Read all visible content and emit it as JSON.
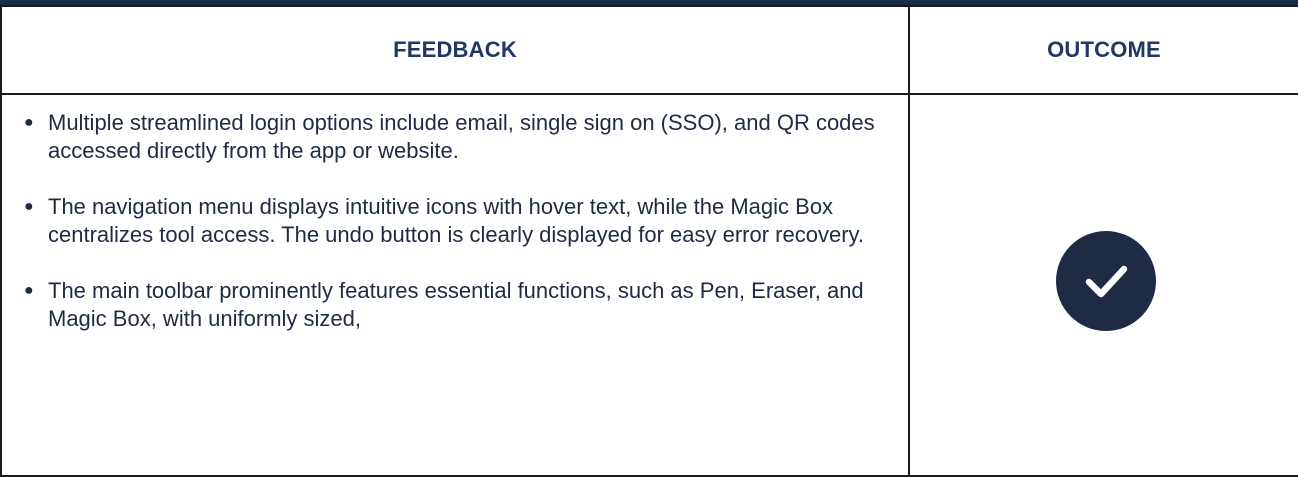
{
  "table": {
    "headers": {
      "feedback": "FEEDBACK",
      "outcome": "OUTCOME"
    },
    "feedback_items": [
      "Multiple streamlined login options include email, single sign on (SSO), and QR codes accessed directly from the app or website.",
      "The navigation menu displays intuitive icons with hover text, while the Magic Box centralizes tool access. The undo button is clearly displayed for easy error recovery.",
      "The main toolbar prominently features essential functions, such as Pen, Eraser, and Magic Box, with uniformly sized,"
    ],
    "outcome_icon": "checkmark-circle-icon",
    "colors": {
      "header_text": "#1f3864",
      "body_text": "#1f2a44",
      "badge": "#1f2a44",
      "top_bar": "#1b2a4a"
    }
  }
}
